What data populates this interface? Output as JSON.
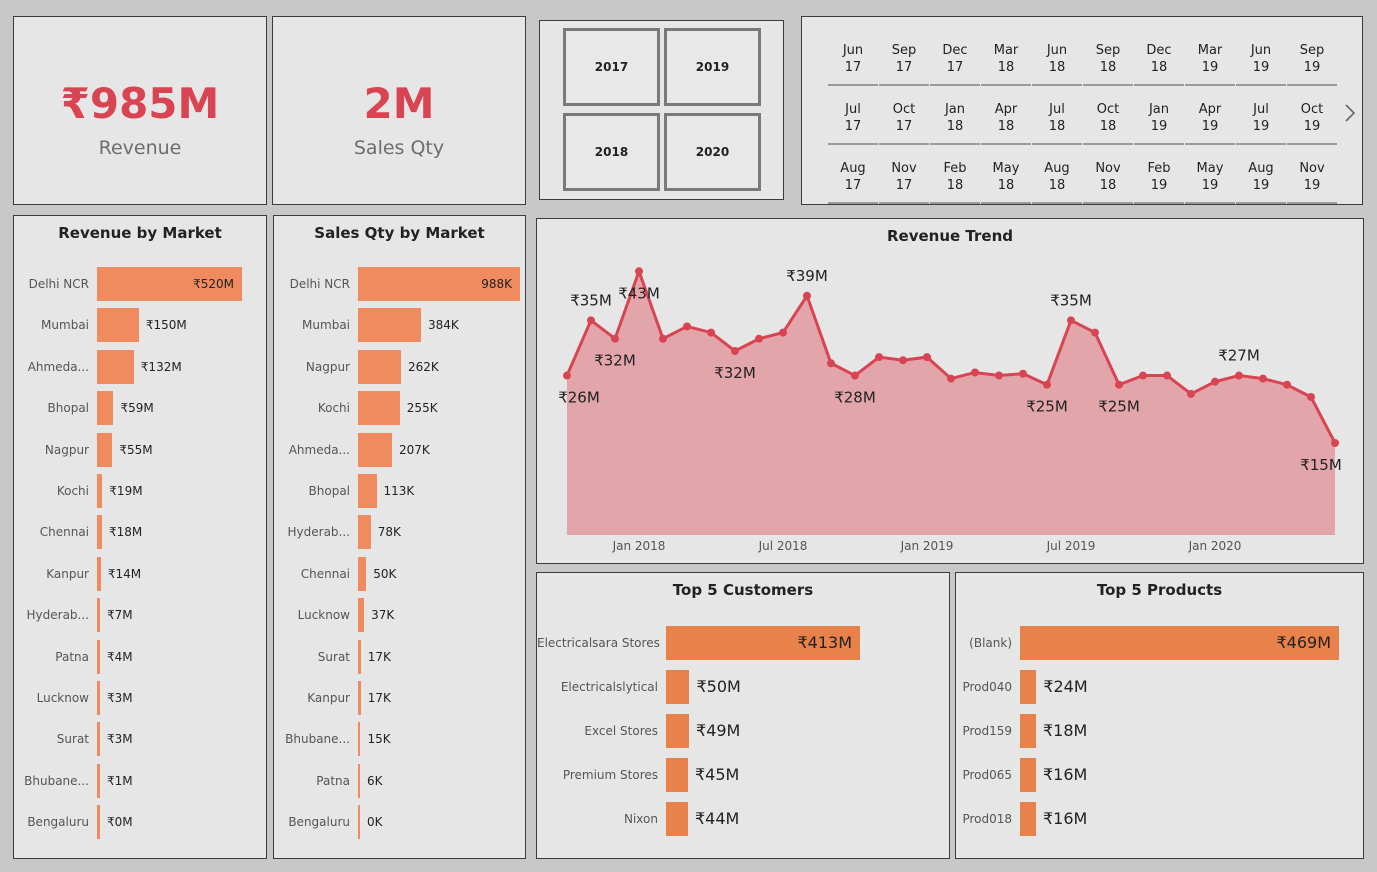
{
  "kpis": {
    "revenue": {
      "value": "₹985M",
      "label": "Revenue"
    },
    "sales_qty": {
      "value": "2M",
      "label": "Sales Qty"
    }
  },
  "year_slicer": {
    "years": [
      "2017",
      "2019",
      "2018",
      "2020"
    ]
  },
  "month_slicer": {
    "months": [
      [
        "Jun",
        "17"
      ],
      [
        "Sep",
        "17"
      ],
      [
        "Dec",
        "17"
      ],
      [
        "Mar",
        "18"
      ],
      [
        "Jun",
        "18"
      ],
      [
        "Sep",
        "18"
      ],
      [
        "Dec",
        "18"
      ],
      [
        "Mar",
        "19"
      ],
      [
        "Jun",
        "19"
      ],
      [
        "Sep",
        "19"
      ],
      [
        "Jul",
        "17"
      ],
      [
        "Oct",
        "17"
      ],
      [
        "Jan",
        "18"
      ],
      [
        "Apr",
        "18"
      ],
      [
        "Jul",
        "18"
      ],
      [
        "Oct",
        "18"
      ],
      [
        "Jan",
        "19"
      ],
      [
        "Apr",
        "19"
      ],
      [
        "Jul",
        "19"
      ],
      [
        "Oct",
        "19"
      ],
      [
        "Aug",
        "17"
      ],
      [
        "Nov",
        "17"
      ],
      [
        "Feb",
        "18"
      ],
      [
        "May",
        "18"
      ],
      [
        "Aug",
        "18"
      ],
      [
        "Nov",
        "18"
      ],
      [
        "Feb",
        "19"
      ],
      [
        "May",
        "19"
      ],
      [
        "Aug",
        "19"
      ],
      [
        "Nov",
        "19"
      ]
    ],
    "next_icon": "chevron-right-icon"
  },
  "colors": {
    "accent": "#d94452",
    "bar": "#ef8b5e",
    "bar_dark": "#e8814a",
    "area": "#e2a5aa"
  },
  "chart_data": [
    {
      "id": "revenue_by_market",
      "type": "bar",
      "title": "Revenue by Market",
      "categories": [
        "Delhi NCR",
        "Mumbai",
        "Ahmeda...",
        "Bhopal",
        "Nagpur",
        "Kochi",
        "Chennai",
        "Kanpur",
        "Hyderab...",
        "Patna",
        "Lucknow",
        "Surat",
        "Bhubane...",
        "Bengaluru"
      ],
      "values": [
        520,
        150,
        132,
        59,
        55,
        19,
        18,
        14,
        7,
        4,
        3,
        3,
        1,
        0
      ],
      "labels": [
        "₹520M",
        "₹150M",
        "₹132M",
        "₹59M",
        "₹55M",
        "₹19M",
        "₹18M",
        "₹14M",
        "₹7M",
        "₹4M",
        "₹3M",
        "₹3M",
        "₹1M",
        "₹0M"
      ]
    },
    {
      "id": "sales_qty_by_market",
      "type": "bar",
      "title": "Sales Qty by Market",
      "categories": [
        "Delhi NCR",
        "Mumbai",
        "Nagpur",
        "Kochi",
        "Ahmeda...",
        "Bhopal",
        "Hyderab...",
        "Chennai",
        "Lucknow",
        "Surat",
        "Kanpur",
        "Bhubane...",
        "Patna",
        "Bengaluru"
      ],
      "values": [
        988,
        384,
        262,
        255,
        207,
        113,
        78,
        50,
        37,
        17,
        17,
        15,
        6,
        0
      ],
      "labels": [
        "988K",
        "384K",
        "262K",
        "255K",
        "207K",
        "113K",
        "78K",
        "50K",
        "37K",
        "17K",
        "17K",
        "15K",
        "6K",
        "0K"
      ]
    },
    {
      "id": "revenue_trend",
      "type": "area",
      "title": "Revenue Trend",
      "x": [
        "2017-10",
        "2017-11",
        "2017-12",
        "2018-01",
        "2018-02",
        "2018-03",
        "2018-04",
        "2018-05",
        "2018-06",
        "2018-07",
        "2018-08",
        "2018-09",
        "2018-10",
        "2018-11",
        "2018-12",
        "2019-01",
        "2019-02",
        "2019-03",
        "2019-04",
        "2019-05",
        "2019-06",
        "2019-07",
        "2019-08",
        "2019-09",
        "2019-10",
        "2019-11",
        "2019-12",
        "2020-01",
        "2020-02",
        "2020-03",
        "2020-04",
        "2020-05",
        "2020-06"
      ],
      "y": [
        26,
        35,
        32,
        43,
        32,
        34,
        33,
        30,
        32,
        33,
        39,
        28,
        26,
        29,
        28.5,
        29,
        25.5,
        26.5,
        26,
        26.3,
        24.5,
        35,
        33,
        24.5,
        26,
        26,
        23,
        25,
        26,
        25.5,
        24.5,
        22.5,
        15
      ],
      "ylim": [
        0,
        45
      ],
      "x_ticks": [
        "Jan 2018",
        "Jul 2018",
        "Jan 2019",
        "Jul 2019",
        "Jan 2020"
      ],
      "x_tick_values": [
        "2018-01",
        "2018-07",
        "2019-01",
        "2019-07",
        "2020-01"
      ],
      "annotations": [
        {
          "x": "2017-10",
          "text": "₹26M",
          "pos": "below"
        },
        {
          "x": "2017-11",
          "text": "₹35M",
          "pos": "above"
        },
        {
          "x": "2017-12",
          "text": "₹32M",
          "pos": "below"
        },
        {
          "x": "2018-01",
          "text": "₹43M",
          "pos": "below"
        },
        {
          "x": "2018-05",
          "text": "₹32M",
          "pos": "below"
        },
        {
          "x": "2018-08",
          "text": "₹39M",
          "pos": "above"
        },
        {
          "x": "2018-10",
          "text": "₹28M",
          "pos": "below"
        },
        {
          "x": "2019-06",
          "text": "₹25M",
          "pos": "below"
        },
        {
          "x": "2019-07",
          "text": "₹35M",
          "pos": "above"
        },
        {
          "x": "2019-09",
          "text": "₹25M",
          "pos": "below"
        },
        {
          "x": "2020-02",
          "text": "₹27M",
          "pos": "above"
        },
        {
          "x": "2020-06",
          "text": "₹15M",
          "pos": "below"
        }
      ]
    },
    {
      "id": "top_customers",
      "type": "bar",
      "title": "Top 5 Customers",
      "categories": [
        "Electricalsara Stores",
        "Electricalslytical",
        "Excel Stores",
        "Premium Stores",
        "Nixon"
      ],
      "values": [
        413,
        50,
        49,
        45,
        44
      ],
      "labels": [
        "₹413M",
        "₹50M",
        "₹49M",
        "₹45M",
        "₹44M"
      ]
    },
    {
      "id": "top_products",
      "type": "bar",
      "title": "Top 5 Products",
      "categories": [
        "(Blank)",
        "Prod040",
        "Prod159",
        "Prod065",
        "Prod018"
      ],
      "values": [
        469,
        24,
        18,
        16,
        16
      ],
      "labels": [
        "₹469M",
        "₹24M",
        "₹18M",
        "₹16M",
        "₹16M"
      ]
    }
  ]
}
